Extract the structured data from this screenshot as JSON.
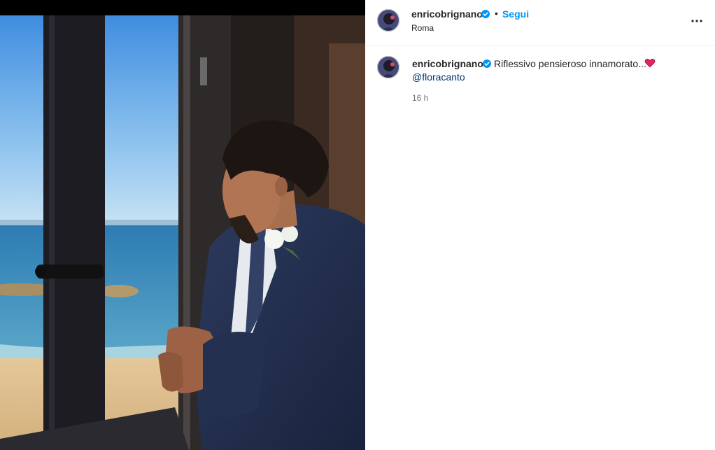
{
  "post": {
    "author": "enricobrignano",
    "follow_label": "Segui",
    "separator": "•",
    "location": "Roma"
  },
  "caption": {
    "author": "enricobrignano",
    "text": "Riflessivo pensieroso innamorato...",
    "mention": "@floracanto",
    "time": "16 h"
  },
  "icons": {
    "verified": "verified-badge-icon",
    "more": "more-options-icon",
    "heart": "red-heart-emoji"
  },
  "colors": {
    "follow": "#0095f6",
    "verified": "#0095f6",
    "heart": "#e0245e"
  }
}
